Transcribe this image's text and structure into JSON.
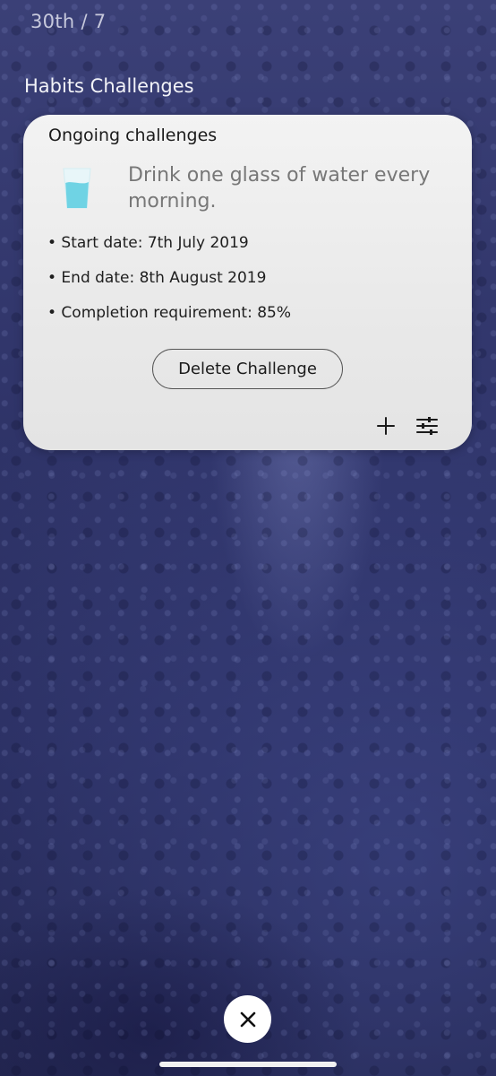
{
  "header": {
    "date": "30th / 7",
    "section_title": "Habits Challenges"
  },
  "card": {
    "title": "Ongoing challenges",
    "habit_icon": "water-glass-icon",
    "habit_text": "Drink one glass of water every morning.",
    "details": {
      "start": "• Start date: 7th July 2019",
      "end": "• End date: 8th August 2019",
      "requirement": "• Completion requirement: 85%"
    },
    "delete_label": "Delete Challenge",
    "actions": [
      "plus-icon",
      "sliders-icon"
    ]
  },
  "footer": {
    "close_icon": "close-icon"
  },
  "colors": {
    "background": "#2c3064",
    "card": "#ececec",
    "water": "#6fd3e4"
  }
}
